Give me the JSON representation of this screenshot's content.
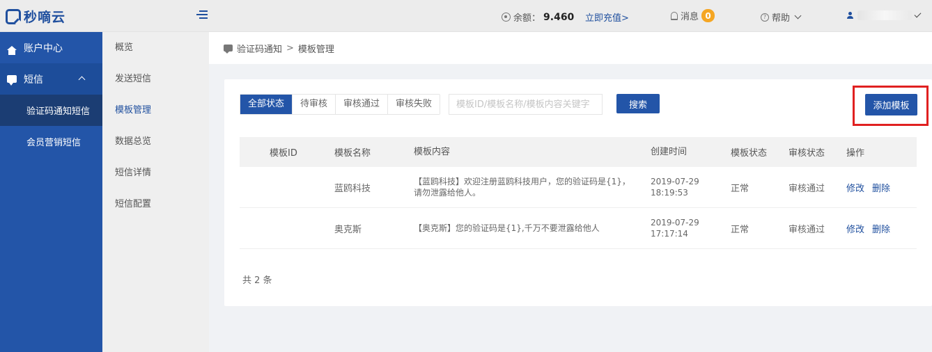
{
  "app": {
    "logo_text": "秒嘀云"
  },
  "topbar": {
    "balance_label": "余额：",
    "balance_value": "9.460",
    "recharge_label": "立即充值>",
    "messages_label": "消息",
    "messages_count": "0",
    "help_label": "帮助"
  },
  "sidebar": {
    "items": [
      {
        "label": "账户中心",
        "icon": "home-icon"
      },
      {
        "label": "短信",
        "icon": "sms-icon"
      }
    ],
    "sub_items": [
      {
        "label": "验证码通知短信"
      },
      {
        "label": "会员营销短信"
      }
    ]
  },
  "submenu": {
    "items": [
      {
        "label": "概览"
      },
      {
        "label": "发送短信"
      },
      {
        "label": "模板管理"
      },
      {
        "label": "数据总览"
      },
      {
        "label": "短信详情"
      },
      {
        "label": "短信配置"
      }
    ]
  },
  "breadcrumb": {
    "parent": "验证码通知",
    "separator": ">",
    "current": "模板管理"
  },
  "filters": {
    "tabs": [
      {
        "label": "全部状态"
      },
      {
        "label": "待审核"
      },
      {
        "label": "审核通过"
      },
      {
        "label": "审核失败"
      }
    ],
    "search_placeholder": "模板ID/模板名称/模板内容关键字",
    "search_button": "搜索",
    "add_button": "添加模板"
  },
  "table": {
    "headers": [
      "模板ID",
      "模板名称",
      "模板内容",
      "创建时间",
      "模板状态",
      "审核状态",
      "操作"
    ],
    "rows": [
      {
        "id": "",
        "name": "蓝鸥科技",
        "content": "【蓝鸥科技】欢迎注册蓝鸥科技用户，您的验证码是{1}，请勿泄露给他人。",
        "created_date": "2019-07-29",
        "created_time": "18:19:53",
        "template_status": "正常",
        "review_status": "审核通过",
        "edit": "修改",
        "delete": "删除"
      },
      {
        "id": "",
        "name": "奥克斯",
        "content": "【奥克斯】您的验证码是{1},千万不要泄露给他人",
        "created_date": "2019-07-29",
        "created_time": "17:17:14",
        "template_status": "正常",
        "review_status": "审核通过",
        "edit": "修改",
        "delete": "删除"
      }
    ],
    "total": "共 2 条"
  }
}
